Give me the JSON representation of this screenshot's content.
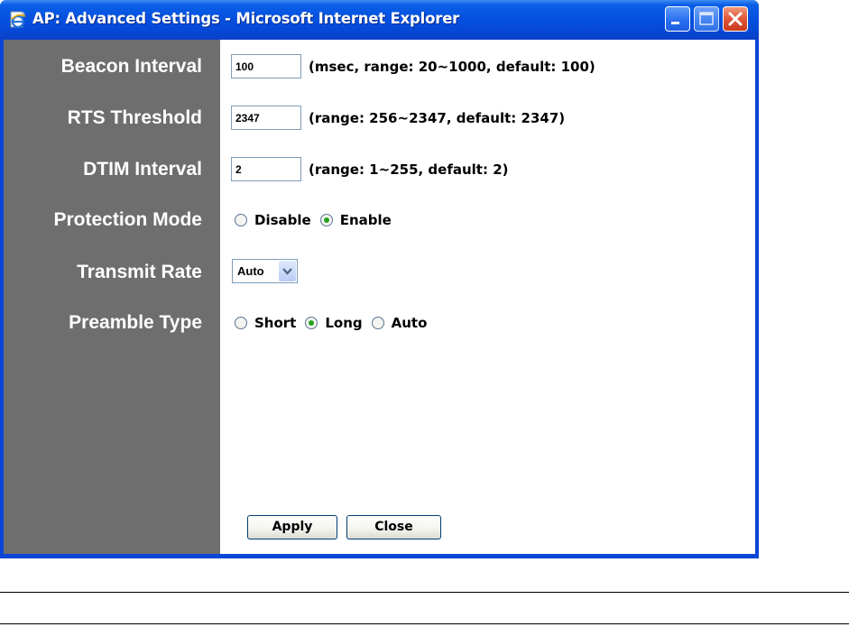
{
  "window": {
    "title": "AP: Advanced Settings - Microsoft Internet Explorer",
    "icon": "ie-page-icon"
  },
  "settings": {
    "beacon_interval": {
      "label": "Beacon Interval",
      "value": "100",
      "hint": "(msec, range: 20~1000, default: 100)"
    },
    "rts_threshold": {
      "label": "RTS Threshold",
      "value": "2347",
      "hint": "(range: 256~2347, default: 2347)"
    },
    "dtim_interval": {
      "label": "DTIM Interval",
      "value": "2",
      "hint": "(range: 1~255, default: 2)"
    },
    "protection_mode": {
      "label": "Protection Mode",
      "options": [
        {
          "label": "Disable",
          "selected": false
        },
        {
          "label": "Enable",
          "selected": true
        }
      ]
    },
    "transmit_rate": {
      "label": "Transmit Rate",
      "value": "Auto"
    },
    "preamble_type": {
      "label": "Preamble Type",
      "options": [
        {
          "label": "Short",
          "selected": false
        },
        {
          "label": "Long",
          "selected": true
        },
        {
          "label": "Auto",
          "selected": false
        }
      ]
    }
  },
  "buttons": {
    "apply": "Apply",
    "close": "Close"
  },
  "colors": {
    "titlebar": "#0551e0",
    "sidebar": "#6e6e6e",
    "close_button": "#e0553a"
  }
}
